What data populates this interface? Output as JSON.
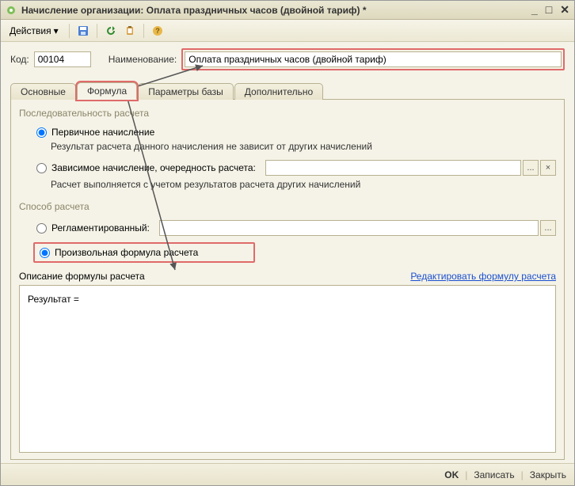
{
  "window": {
    "title": "Начисление организации: Оплата праздничных часов (двойной тариф) *"
  },
  "toolbar": {
    "actions_label": "Действия"
  },
  "fields": {
    "code_label": "Код:",
    "code_value": "00104",
    "name_label": "Наименование:",
    "name_value": "Оплата праздничных часов (двойной тариф)"
  },
  "tabs": {
    "main": "Основные",
    "formula": "Формула",
    "params": "Параметры базы",
    "extra": "Дополнительно"
  },
  "sequence": {
    "title": "Последовательность расчета",
    "primary": "Первичное начисление",
    "primary_hint": "Результат расчета данного начисления не зависит от других начислений",
    "dependent": "Зависимое начисление, очередность расчета:",
    "dependent_hint": "Расчет выполняется с учетом результатов расчета других начислений"
  },
  "method": {
    "title": "Способ расчета",
    "regulated": "Регламентированный:",
    "arbitrary": "Произвольная формула расчета"
  },
  "formula": {
    "desc_label": "Описание формулы расчета",
    "edit_link": "Редактировать формулу расчета",
    "body": "Результат ="
  },
  "footer": {
    "ok": "OK",
    "save": "Записать",
    "close": "Закрыть"
  },
  "lookup": {
    "ellipsis": "...",
    "clear": "×"
  }
}
